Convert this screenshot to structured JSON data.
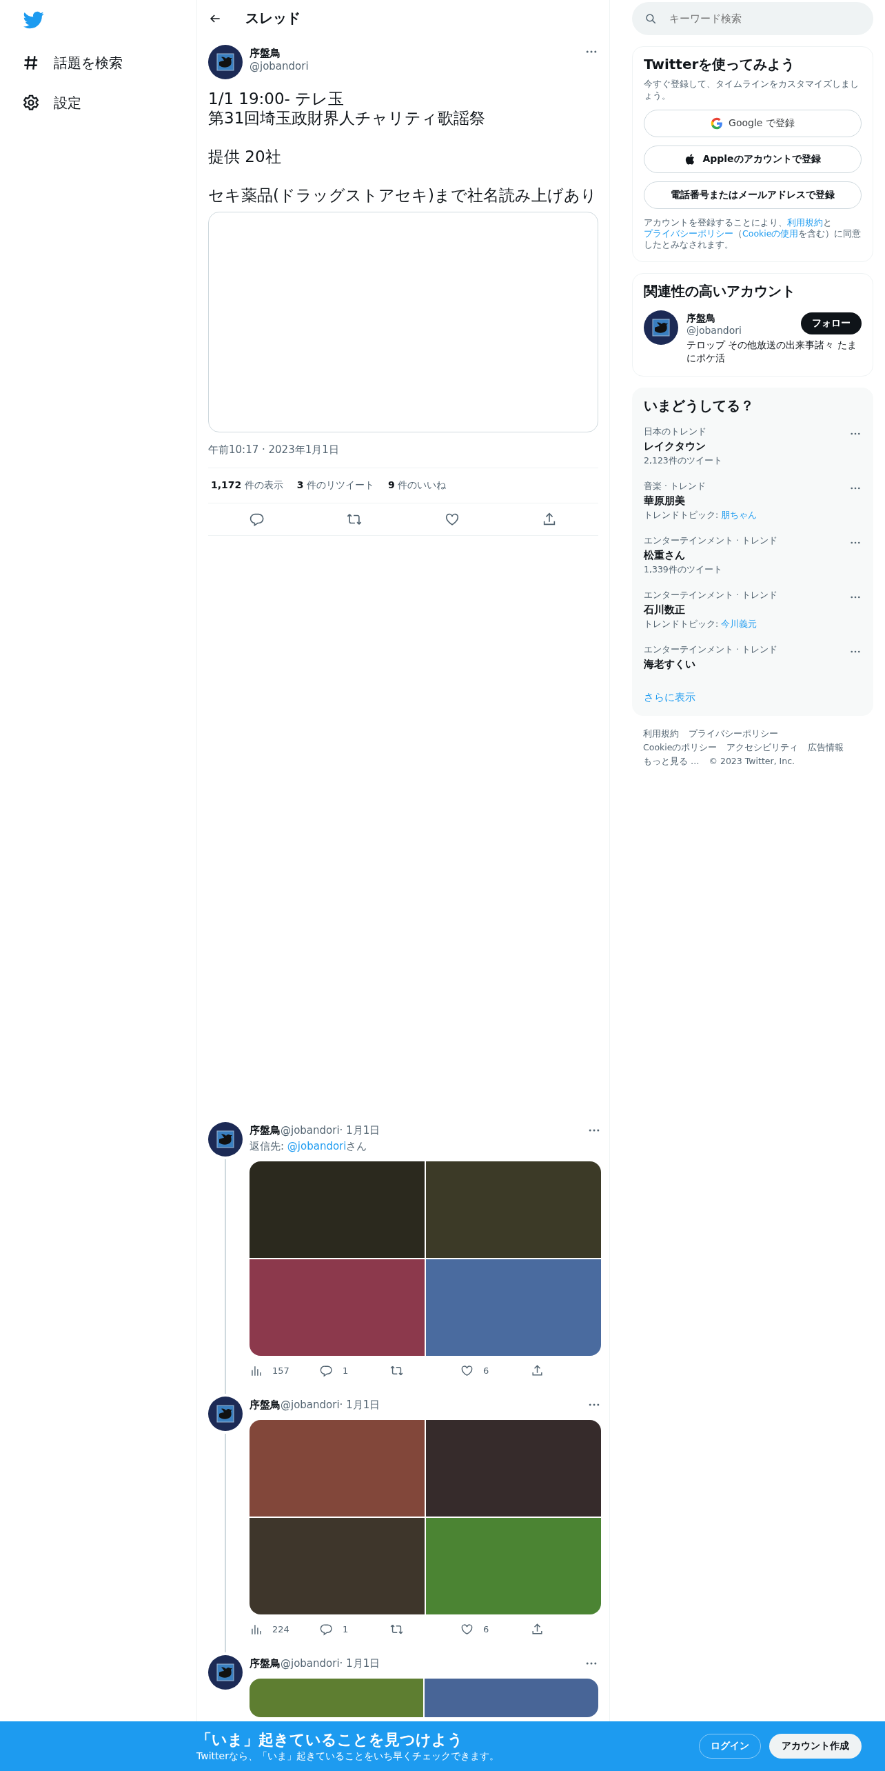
{
  "sidebar": {
    "items": [
      {
        "kind": "hashtag",
        "label": "話題を検索"
      },
      {
        "kind": "settings",
        "label": "設定"
      }
    ]
  },
  "header": {
    "title": "スレッド"
  },
  "main_tweet": {
    "name": "序盤鳥",
    "handle": "@jobandori",
    "paragraphs": [
      [
        "1/1 19:00- テレ玉",
        "第31回埼玉政財界人チャリティ歌謡祭"
      ],
      [
        "提供 20社"
      ],
      [
        "セキ薬品(ドラッグストアセキ)まで社名読み上げあり"
      ]
    ],
    "timestamp": "午前10:17 · 2023年1月1日",
    "stats": [
      {
        "count": "1,172",
        "label": "件の表示"
      },
      {
        "count": "3",
        "label": "件のリツイート"
      },
      {
        "count": "9",
        "label": "件のいいね"
      }
    ]
  },
  "replies": [
    {
      "name": "序盤鳥",
      "handle": "@jobandori",
      "date": "· 1月1日",
      "reply_to": {
        "prefix": "返信先: ",
        "link": "@jobandori",
        "suffix": "さん"
      },
      "images": [
        {
          "color": "#2b291e"
        },
        {
          "color": "#3c3a27"
        },
        {
          "color": "#8c394c"
        },
        {
          "color": "#4a6b9f"
        }
      ],
      "views": "157",
      "reply_count": "1",
      "likes": "6"
    },
    {
      "name": "序盤鳥",
      "handle": "@jobandori",
      "date": "· 1月1日",
      "images": [
        {
          "color": "#82473a"
        },
        {
          "color": "#362b2b"
        },
        {
          "color": "#3e362b"
        },
        {
          "color": "#4b8433"
        }
      ],
      "views": "224",
      "reply_count": "1",
      "likes": "6"
    },
    {
      "name": "序盤鳥",
      "handle": "@jobandori",
      "date": "· 1月1日",
      "images": [
        {
          "color": "#5e7e31"
        },
        {
          "color": "#486597"
        }
      ]
    }
  ],
  "search": {
    "placeholder": "キーワード検索"
  },
  "signup_card": {
    "title": "Twitterを使ってみよう",
    "subtitle": "今すぐ登録して、タイムラインをカスタマイズしましょう。",
    "buttons": [
      {
        "kind": "google",
        "label": "Google で登録"
      },
      {
        "kind": "apple",
        "label": "Appleのアカウントで登録"
      },
      {
        "kind": "plain",
        "label": "電話番号またはメールアドレスで登録"
      }
    ],
    "legal": [
      {
        "kind": "text",
        "text": "アカウントを登録することにより、"
      },
      {
        "kind": "link",
        "text": "利用規約"
      },
      {
        "kind": "text",
        "text": "と"
      },
      {
        "kind": "link",
        "text": "プライバシーポリシー"
      },
      {
        "kind": "text",
        "text": "（"
      },
      {
        "kind": "link",
        "text": "Cookieの使用"
      },
      {
        "kind": "text",
        "text": "を含む）に同意したとみなされます。"
      }
    ]
  },
  "related": {
    "title": "関連性の高いアカウント",
    "name": "序盤鳥",
    "handle": "@jobandori",
    "bio": "テロップ その他放送の出来事諸々 たまにポケ活",
    "follow_label": "フォロー"
  },
  "trends": {
    "title": "いまどうしてる？",
    "items": [
      {
        "context": "日本のトレンド",
        "name": "レイクタウン",
        "detail": "2,123件のツイート"
      },
      {
        "context": "音楽 · トレンド",
        "name": "華原朋美",
        "detail": "トレンドトピック: ",
        "topic": "朋ちゃん"
      },
      {
        "context": "エンターテインメント · トレンド",
        "name": "松重さん",
        "detail": "1,339件のツイート"
      },
      {
        "context": "エンターテインメント · トレンド",
        "name": "石川数正",
        "detail": "トレンドトピック: ",
        "topic": "今川義元"
      },
      {
        "context": "エンターテインメント · トレンド",
        "name": "海老すくい"
      }
    ],
    "show_more": "さらに表示"
  },
  "footer": [
    [
      "利用規約",
      "プライバシーポリシー"
    ],
    [
      "Cookieのポリシー",
      "アクセシビリティ",
      "広告情報"
    ],
    [
      "もっと見る …",
      "© 2023 Twitter, Inc."
    ]
  ],
  "bottom_bar": {
    "title": "「いま」起きていることを見つけよう",
    "subtitle": "Twitterなら、「いま」起きていることをいち早くチェックできます。",
    "login": "ログイン",
    "signup": "アカウント作成"
  }
}
